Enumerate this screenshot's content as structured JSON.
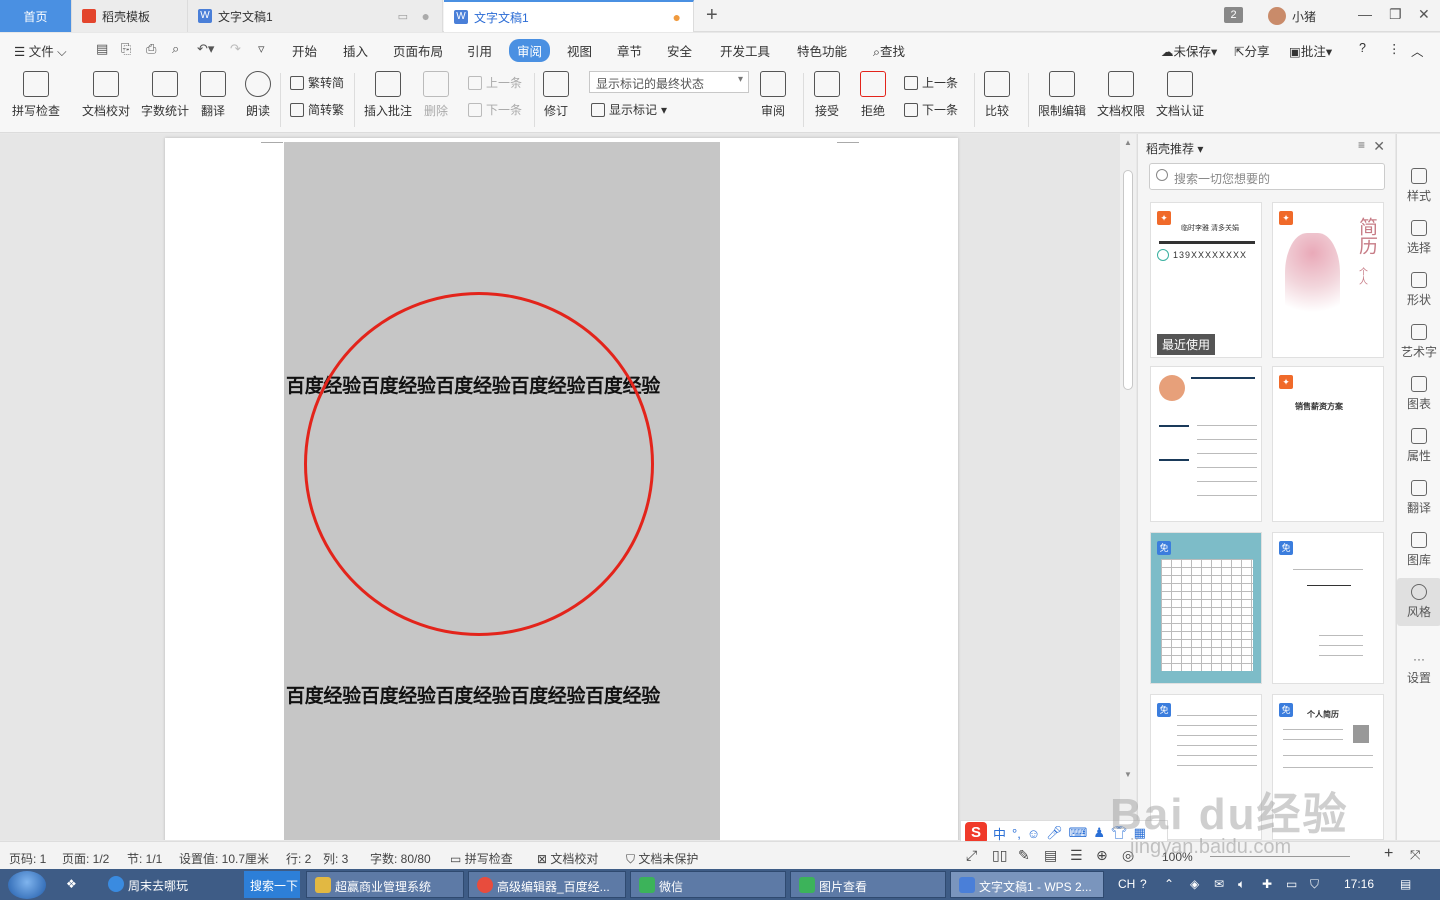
{
  "tabs": [
    {
      "label": "首页"
    },
    {
      "label": "稻壳模板"
    },
    {
      "label": "文字文稿1"
    },
    {
      "label": "文字文稿1"
    }
  ],
  "window": {
    "badge": "2",
    "user": "小猪"
  },
  "menu": {
    "file": "文件",
    "items": [
      "开始",
      "插入",
      "页面布局",
      "引用",
      "审阅",
      "视图",
      "章节",
      "安全",
      "开发工具",
      "特色功能"
    ],
    "active": "审阅",
    "search": "查找",
    "unsaved": "未保存",
    "share": "分享",
    "annotate": "批注"
  },
  "ribbon": {
    "spell_check": "拼写检查",
    "doc_proof": "文档校对",
    "word_count": "字数统计",
    "translate": "翻译",
    "read_aloud": "朗读",
    "to_traditional": "繁转简",
    "to_simplified": "简转繁",
    "insert_comment": "插入批注",
    "delete": "删除",
    "prev": "上一条",
    "next": "下一条",
    "revise": "修订",
    "markup_dropdown": "显示标记的最终状态",
    "show_markup": "显示标记",
    "review": "审阅",
    "accept": "接受",
    "reject": "拒绝",
    "prev2": "上一条",
    "next2": "下一条",
    "compare": "比较",
    "restrict_edit": "限制编辑",
    "doc_rights": "文档权限",
    "doc_auth": "文档认证"
  },
  "document": {
    "line1": "百度经验百度经验百度经验百度经验百度经验",
    "line2": "百度经验百度经验百度经验百度经验百度经验",
    "circle_color": "#e3241b",
    "block_color": "#c6c6c6"
  },
  "panel": {
    "title": "稻壳推荐",
    "search_placeholder": "搜索一切您想要的",
    "recent_label": "最近使用",
    "card_texts": {
      "resume_name_line": "临时李雅  清多关娟",
      "phone": "139XXXXXXXX",
      "jianli": "简历",
      "geren": "个人",
      "sales": "销售薪资方案",
      "personal_resume": "个人简历",
      "free": "免"
    }
  },
  "sidebar": [
    "样式",
    "选择",
    "形状",
    "艺术字",
    "图表",
    "属性",
    "翻译",
    "图库",
    "风格",
    "设置"
  ],
  "status": {
    "page_code": "页码: 1",
    "pages": "页面: 1/2",
    "section": "节: 1/1",
    "setting": "设置值: 10.7厘米",
    "row": "行: 2",
    "col": "列: 3",
    "words": "字数: 80/80",
    "spell": "拼写检查",
    "proof": "文档校对",
    "protect": "文档未保护",
    "zoom": "100%"
  },
  "ime": {
    "logo": "S",
    "mode": "中"
  },
  "taskbar": {
    "items": [
      "周末去哪玩",
      "搜索一下",
      "超赢商业管理系统",
      "高级编辑器_百度经...",
      "微信",
      "图片查看",
      "文字文稿1 - WPS 2..."
    ],
    "lang": "CH",
    "time": "17:16"
  },
  "watermark": {
    "logo": "Bai du经验",
    "url": "jingyan.baidu.com"
  }
}
